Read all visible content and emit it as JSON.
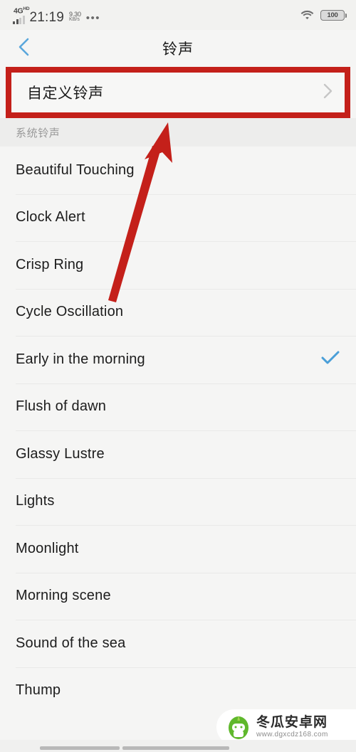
{
  "status_bar": {
    "network_type": "4G",
    "network_suffix": "HD",
    "time": "21:19",
    "speed_value": "9.30",
    "speed_unit": "KB/s",
    "overflow": "•••",
    "wifi_icon": "wifi-icon",
    "battery_level": "100"
  },
  "header": {
    "back_icon": "chevron-left-icon",
    "title": "铃声"
  },
  "custom_ringtone": {
    "label": "自定义铃声",
    "chevron_icon": "chevron-right-icon"
  },
  "section": {
    "title": "系统铃声"
  },
  "ringtones": [
    {
      "name": "Beautiful Touching",
      "selected": false
    },
    {
      "name": "Clock Alert",
      "selected": false
    },
    {
      "name": "Crisp Ring",
      "selected": false
    },
    {
      "name": "Cycle Oscillation",
      "selected": false
    },
    {
      "name": "Early in the morning",
      "selected": true
    },
    {
      "name": "Flush of dawn",
      "selected": false
    },
    {
      "name": "Glassy Lustre",
      "selected": false
    },
    {
      "name": "Lights",
      "selected": false
    },
    {
      "name": "Moonlight",
      "selected": false
    },
    {
      "name": "Morning scene",
      "selected": false
    },
    {
      "name": "Sound of the sea",
      "selected": false
    },
    {
      "name": "Thump",
      "selected": false
    }
  ],
  "annotations": {
    "highlight_color": "#c4201a",
    "arrow_color": "#c4201a",
    "arrow_name": "red-arrow-pointing-to-custom-ringtone"
  },
  "watermark": {
    "name": "冬瓜安卓网",
    "url": "www.dgxcdz168.com"
  },
  "colors": {
    "accent_blue": "#5aa7db",
    "check_blue": "#4a9fd8",
    "background": "#f5f5f4",
    "section_bg": "#ededec",
    "text_primary": "#1c1c1c",
    "text_muted": "#999999"
  }
}
